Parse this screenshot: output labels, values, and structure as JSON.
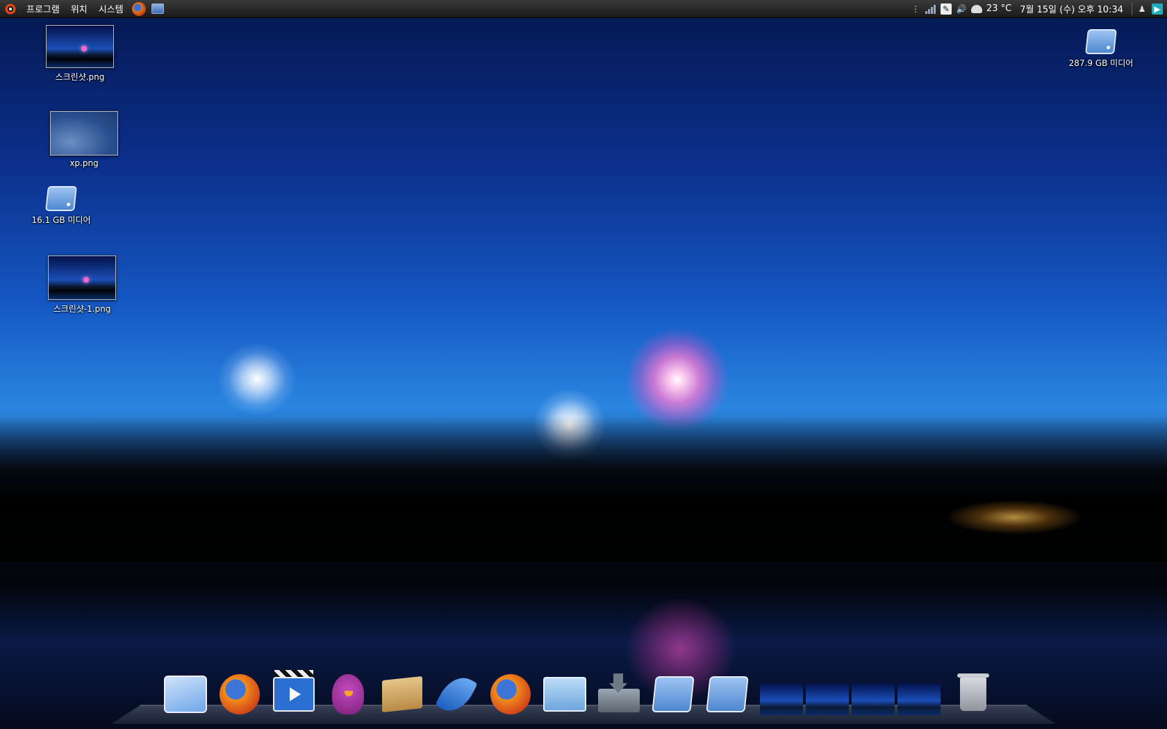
{
  "panel": {
    "menus": [
      "프로그램",
      "위치",
      "시스템"
    ],
    "temperature": "23 °C",
    "clock": "7월 15일 (수) 오후 10:34"
  },
  "desktop": {
    "icons": [
      {
        "label": "스크린샷.png",
        "icon": "image-thumbnail"
      },
      {
        "label": "xp.png",
        "icon": "image-thumbnail"
      },
      {
        "label": "16.1 GB 미디어",
        "icon": "drive-icon"
      },
      {
        "label": "스크린샷-1.png",
        "icon": "image-thumbnail"
      }
    ],
    "right_icon": {
      "label": "287.9 GB 미디어",
      "icon": "drive-icon"
    }
  },
  "dock": {
    "items": [
      "desktop-icon",
      "firefox-icon",
      "video-player-icon",
      "pidgin-icon",
      "package-icon",
      "feather-icon",
      "firefox-icon",
      "folder-icon",
      "download-icon",
      "drive-icon",
      "drive-icon",
      "window-thumbnails",
      "trash-icon"
    ]
  },
  "colors": {
    "panel_bg": "#2a2a2a",
    "ubuntu_orange": "#dd4814",
    "firework_pink": "#ff78d2"
  }
}
